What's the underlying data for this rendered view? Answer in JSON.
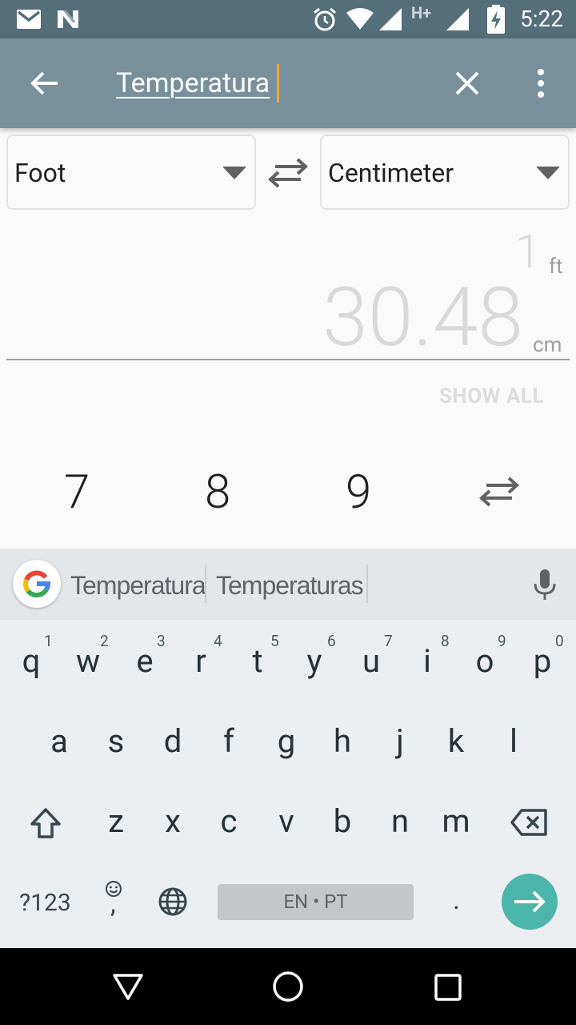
{
  "status_bar": {
    "time": "5:22",
    "network_type": "H+",
    "icons": [
      "gmail-icon",
      "n-app-icon",
      "alarm-icon",
      "wifi-icon",
      "signal-icon",
      "battery-charging-icon"
    ]
  },
  "toolbar": {
    "search_value": "Temperatura",
    "icons": [
      "back-arrow-icon",
      "clear-icon",
      "more-vert-icon"
    ]
  },
  "converter": {
    "from_unit": "Foot",
    "to_unit": "Centimeter",
    "input_value": "1",
    "input_unit": "ft",
    "result_value": "30.48",
    "result_unit": "cm",
    "show_all_label": "SHOW ALL",
    "keypad": [
      "7",
      "8",
      "9"
    ]
  },
  "keyboard": {
    "suggestions": [
      "Temperatura",
      "Temperaturas"
    ],
    "row1": [
      "q",
      "w",
      "e",
      "r",
      "t",
      "y",
      "u",
      "i",
      "o",
      "p"
    ],
    "row1_hints": [
      "1",
      "2",
      "3",
      "4",
      "5",
      "6",
      "7",
      "8",
      "9",
      "0"
    ],
    "row2": [
      "a",
      "s",
      "d",
      "f",
      "g",
      "h",
      "j",
      "k",
      "l"
    ],
    "row3": [
      "z",
      "x",
      "c",
      "v",
      "b",
      "n",
      "m"
    ],
    "symbols_label": "?123",
    "comma_label": ",",
    "space_label": "EN • PT",
    "period_label": ".",
    "accent_color": "#4db6ac"
  },
  "colors": {
    "status_bar": "#546e7a",
    "toolbar": "#78909c",
    "caret": "#f0a92b"
  }
}
